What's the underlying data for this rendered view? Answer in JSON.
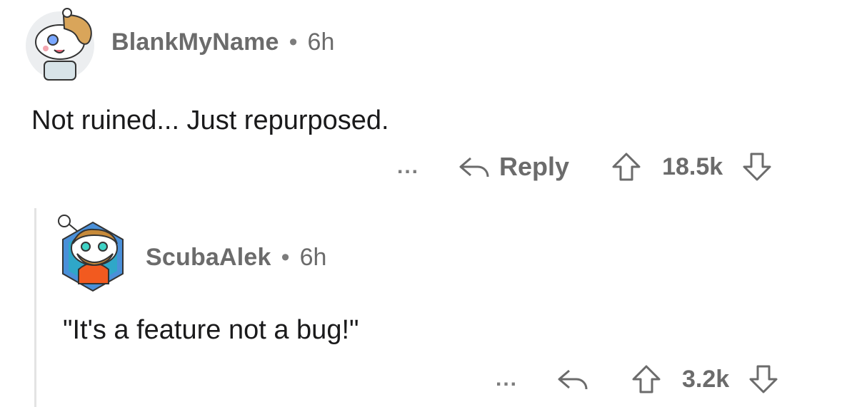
{
  "comments": [
    {
      "username": "BlankMyName",
      "separator": "•",
      "time": "6h",
      "body": "Not ruined... Just repurposed.",
      "more_label": "...",
      "reply_label": "Reply",
      "score": "18.5k",
      "avatar_icon": "snoo-avatar-icon"
    },
    {
      "username": "ScubaAlek",
      "separator": "•",
      "time": "6h",
      "body": "\"It's a feature not a bug!\"",
      "more_label": "...",
      "score": "3.2k",
      "avatar_icon": "snoo-avatar-icon"
    }
  ]
}
